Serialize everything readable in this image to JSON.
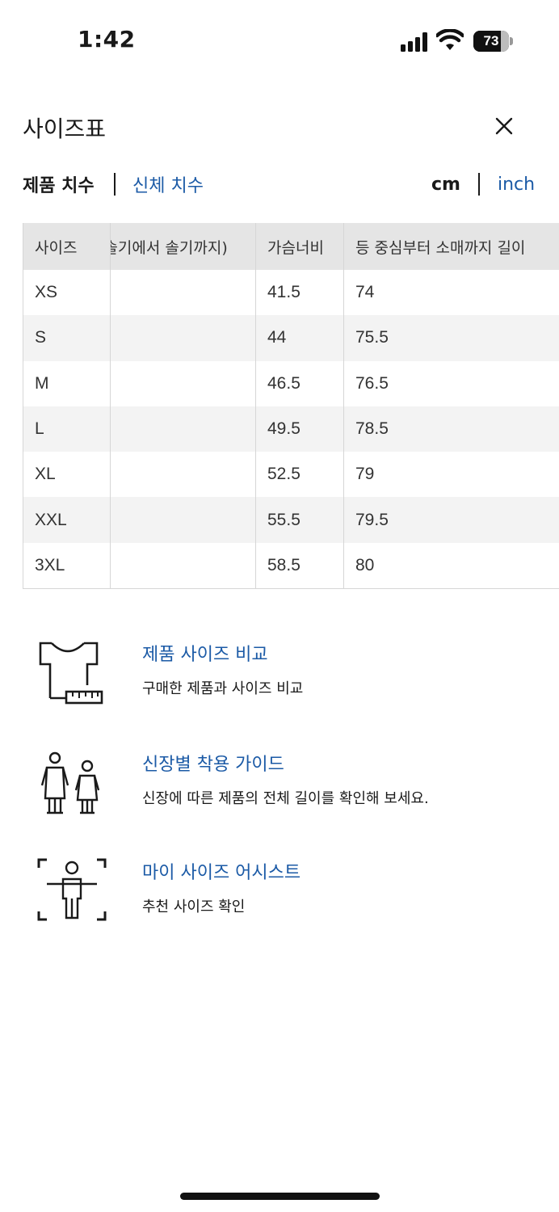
{
  "status_bar": {
    "time": "1:42",
    "battery_percent": "73"
  },
  "header": {
    "title": "사이즈표",
    "close_icon": "close-icon"
  },
  "tabs": {
    "product": "제품 치수",
    "body": "신체 치수",
    "active": "product"
  },
  "units": {
    "cm": "cm",
    "inch": "inch",
    "active": "cm"
  },
  "table": {
    "headers": [
      "사이즈",
      "(솔기에서 솔기까지)",
      "가슴너비",
      "등 중심부터 소매까지 길이"
    ],
    "rows": [
      [
        "XS",
        "",
        "41.5",
        "74"
      ],
      [
        "S",
        "",
        "44",
        "75.5"
      ],
      [
        "M",
        "",
        "46.5",
        "76.5"
      ],
      [
        "L",
        "",
        "49.5",
        "78.5"
      ],
      [
        "XL",
        "",
        "52.5",
        "79"
      ],
      [
        "XXL",
        "",
        "55.5",
        "79.5"
      ],
      [
        "3XL",
        "",
        "58.5",
        "80"
      ]
    ]
  },
  "guides": [
    {
      "icon": "tshirt-ruler-icon",
      "title": "제품 사이즈 비교",
      "description": "구매한 제품과 사이즈 비교"
    },
    {
      "icon": "two-figures-icon",
      "title": "신장별 착용 가이드",
      "description": "신장에 따른 제품의 전체 길이를 확인해 보세요."
    },
    {
      "icon": "body-scan-icon",
      "title": "마이 사이즈 어시스트",
      "description": "추천 사이즈 확인"
    }
  ],
  "colors": {
    "link": "#1b5aa6",
    "header_bg": "#e5e5e5",
    "stripe_bg": "#f3f3f3"
  }
}
